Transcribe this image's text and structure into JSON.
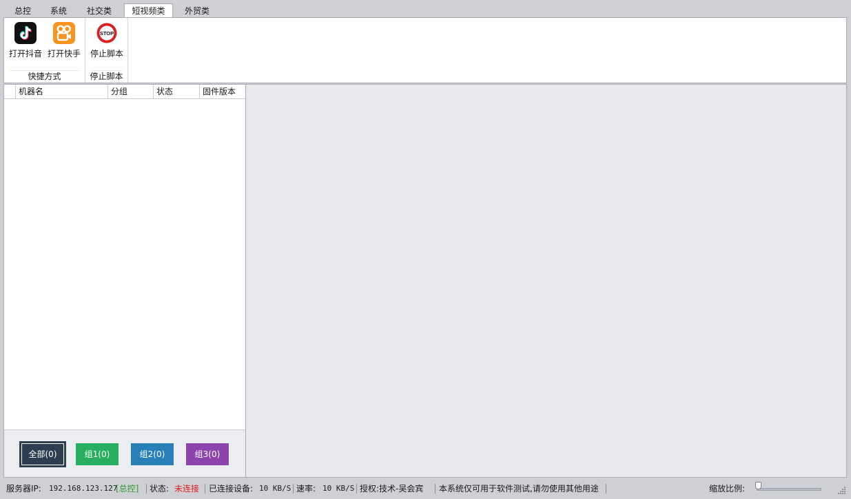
{
  "tabs": [
    {
      "label": "总控",
      "active": false
    },
    {
      "label": "系统",
      "active": false
    },
    {
      "label": "社交类",
      "active": false
    },
    {
      "label": "短视频类",
      "active": true
    },
    {
      "label": "外贸类",
      "active": false
    }
  ],
  "ribbon": {
    "groups": [
      {
        "label": "快捷方式",
        "buttons": [
          {
            "label": "打开抖音",
            "icon": "douyin-icon"
          },
          {
            "label": "打开快手",
            "icon": "kuaishou-icon"
          }
        ]
      },
      {
        "label": "停止脚本",
        "buttons": [
          {
            "label": "停止脚本",
            "icon": "stop-icon",
            "icon_text": "STOP"
          }
        ]
      }
    ]
  },
  "device_grid": {
    "columns": [
      "机器名",
      "分组",
      "状态",
      "固件版本"
    ],
    "rows": []
  },
  "group_buttons": [
    {
      "label": "全部(0)",
      "color": "#2c3e50"
    },
    {
      "label": "组1(0)",
      "color": "#27ae60"
    },
    {
      "label": "组2(0)",
      "color": "#2980b9"
    },
    {
      "label": "组3(0)",
      "color": "#8e44ad"
    }
  ],
  "statusbar": {
    "server_ip_label": "服务器IP:",
    "server_ip": "192.168.123.127",
    "mode": "[总控]",
    "status_label": "状态:",
    "status_value": "未连接",
    "connected_label": "已连接设备:",
    "connected_value": "10 KB/S",
    "rate_label": "速率:",
    "rate_value": "10 KB/S",
    "license": "授权:技术-吴会宾",
    "notice": "本系统仅可用于软件测试,请勿使用其他用途",
    "zoom_label": "缩放比例:",
    "zoom_level": 0
  },
  "colors": {
    "status_disconnected": "#e02020",
    "mode_green": "#2a9a2a",
    "douyin_bg": "#111111",
    "kuaishou_bg": "#f7931e",
    "stop_red": "#d9201f"
  }
}
